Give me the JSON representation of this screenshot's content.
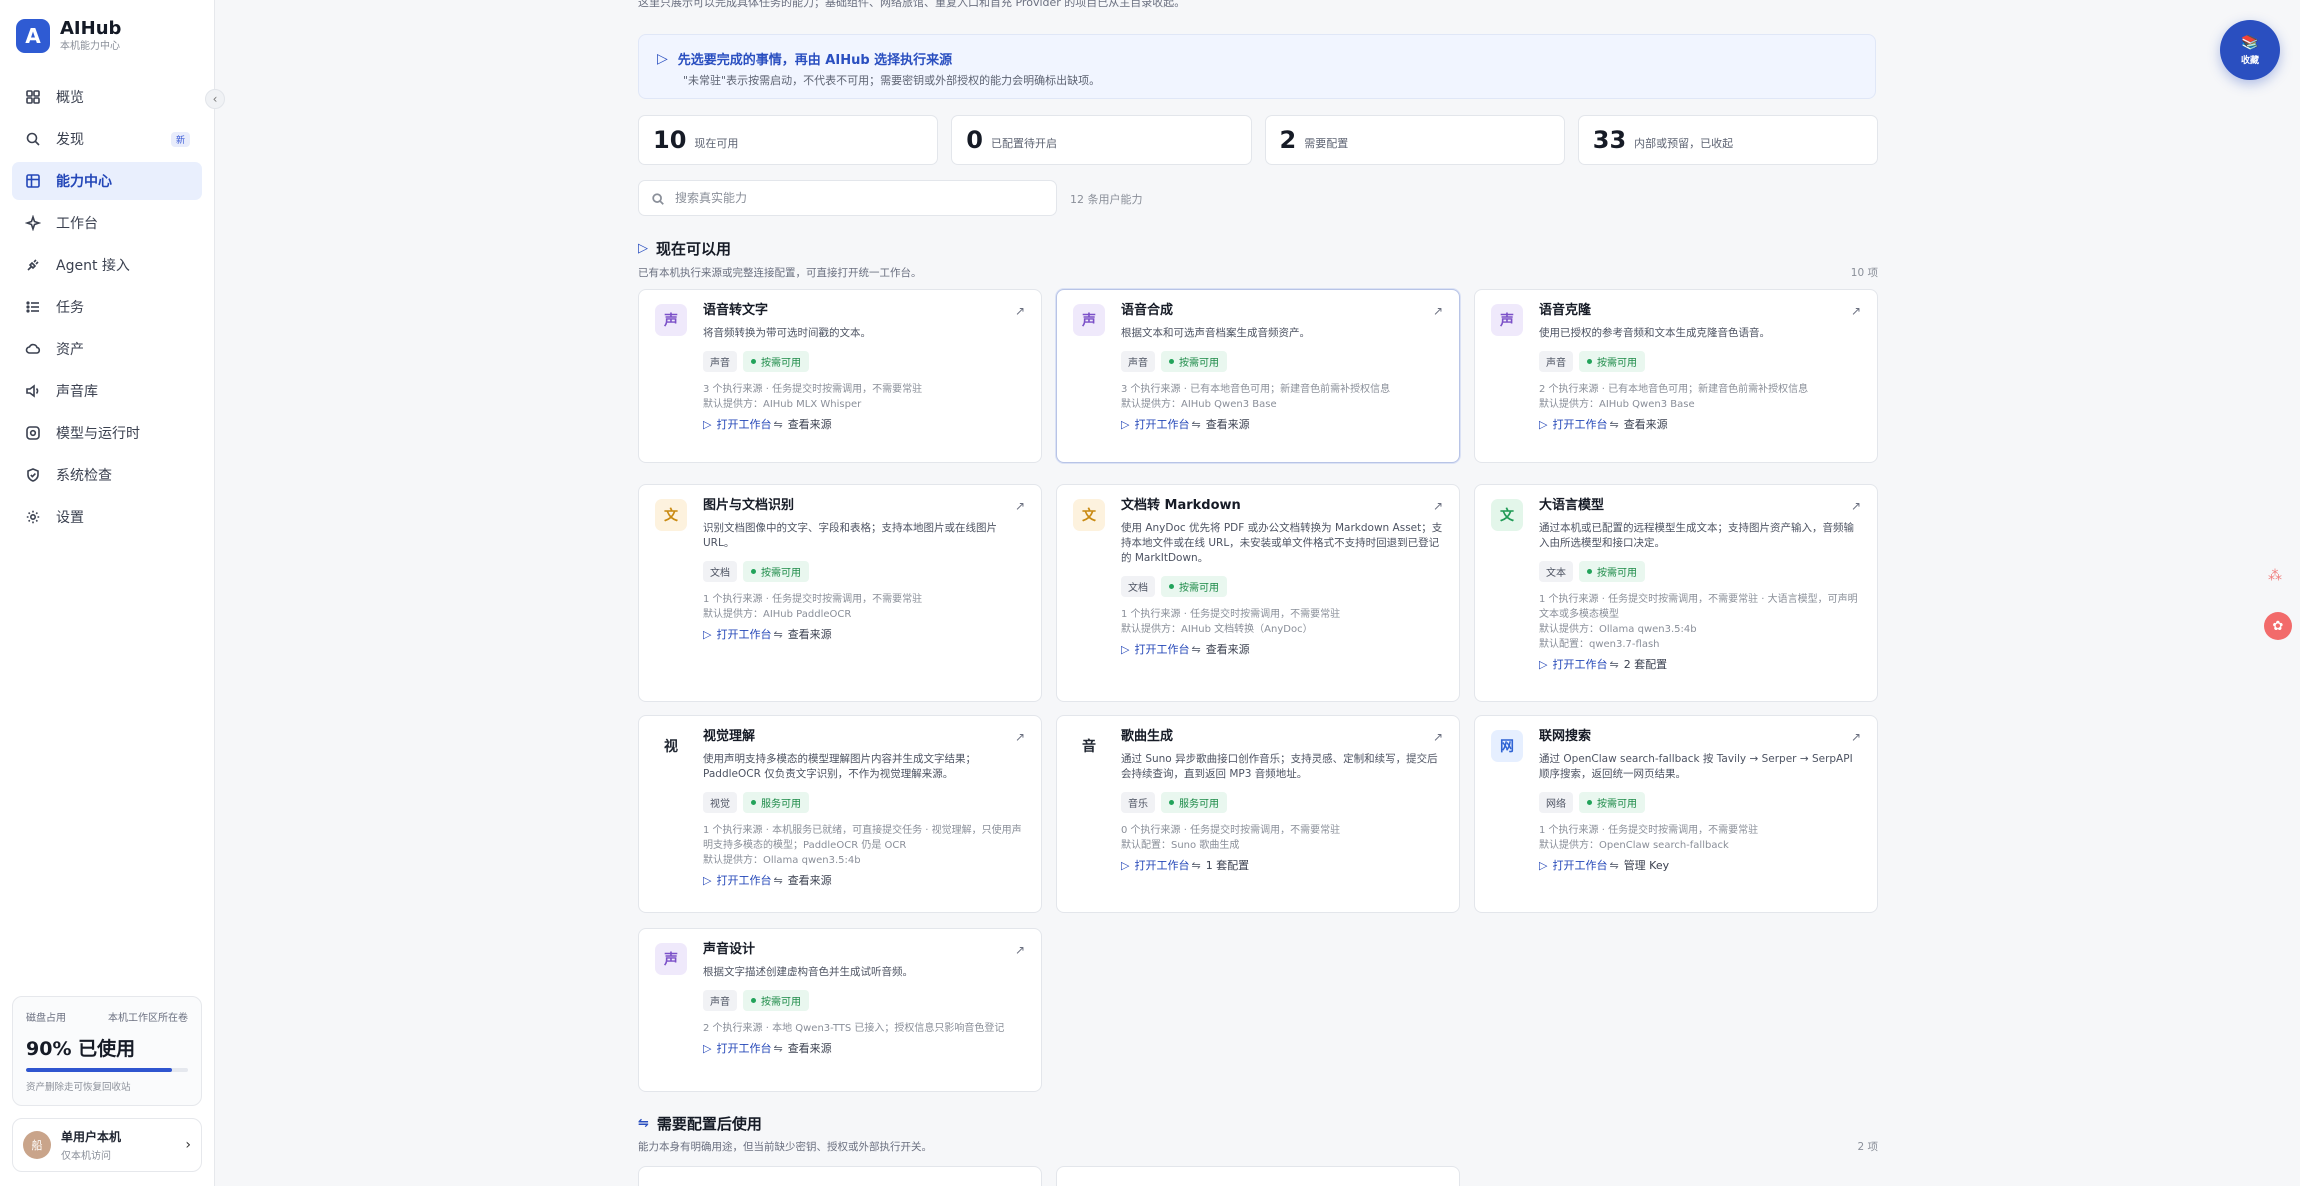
{
  "brand": {
    "logo": "A",
    "name": "AIHub",
    "subtitle": "本机能力中心"
  },
  "sidebar": {
    "collapse_icon": "‹",
    "items": [
      {
        "label": "概览",
        "icon": "grid-icon"
      },
      {
        "label": "发现",
        "icon": "search-icon",
        "badge": "新"
      },
      {
        "label": "能力中心",
        "icon": "table-icon",
        "active": true
      },
      {
        "label": "工作台",
        "icon": "sparkle-icon"
      },
      {
        "label": "Agent 接入",
        "icon": "plug-icon"
      },
      {
        "label": "任务",
        "icon": "list-icon"
      },
      {
        "label": "资产",
        "icon": "cloud-icon"
      },
      {
        "label": "声音库",
        "icon": "sound-icon"
      },
      {
        "label": "模型与运行时",
        "icon": "cog-icon"
      },
      {
        "label": "系统检查",
        "icon": "shield-icon"
      },
      {
        "label": "设置",
        "icon": "gear-icon"
      }
    ],
    "disk": {
      "label": "磁盘占用",
      "location": "本机工作区所在卷",
      "value": "90% 已使用",
      "percent": 0.9,
      "note": "资产删除走可恢复回收站"
    },
    "user": {
      "avatar": "船",
      "name": "单用户本机",
      "sub": "仅本机访问",
      "chevron": "›"
    }
  },
  "main": {
    "intro": "这里只展示可以完成具体任务的能力；基础组件、网络旅馆、重复入口和首充 Provider 的项目已从主目录收起。",
    "banner": {
      "icon": "▷",
      "title": "先选要完成的事情，再由 AIHub 选择执行来源",
      "desc": "\"未常驻\"表示按需启动，不代表不可用；需要密钥或外部授权的能力会明确标出缺项。"
    },
    "stats": [
      {
        "num": "10",
        "label": "现在可用"
      },
      {
        "num": "0",
        "label": "已配置待开启"
      },
      {
        "num": "2",
        "label": "需要配置"
      },
      {
        "num": "33",
        "label": "内部或预留，已收起"
      }
    ],
    "search": {
      "placeholder": "搜索真实能力",
      "count": "12 条用户能力"
    },
    "section1": {
      "icon": "▷",
      "title": "现在可以用",
      "subtitle": "已有本机执行来源或完整连接配置，可直接打开统一工作台。",
      "count": "10 项"
    },
    "section2": {
      "icon": "⇋",
      "title": "需要配置后使用",
      "subtitle": "能力本身有明确用途，但当前缺少密钥、授权或外部执行开关。",
      "count": "2 项"
    },
    "cards": [
      {
        "glyph": "声",
        "theme": "purple",
        "title": "语音转文字",
        "desc": "将音频转换为带可选时间戳的文本。",
        "tag": "声音",
        "status": "按需可用",
        "meta": "3 个执行来源 · 任务提交时按需调用，不需要常驻",
        "meta2": "默认提供方：AIHub MLX Whisper",
        "meta3": "",
        "open": "打开工作台",
        "secondary": "查看来源"
      },
      {
        "glyph": "声",
        "theme": "purple",
        "title": "语音合成",
        "desc": "根据文本和可选声音档案生成音频资产。",
        "tag": "声音",
        "status": "按需可用",
        "meta": "3 个执行来源 · 已有本地音色可用；新建音色前需补授权信息",
        "meta2": "默认提供方：AIHub Qwen3 Base",
        "meta3": "",
        "open": "打开工作台",
        "secondary": "查看来源"
      },
      {
        "glyph": "声",
        "theme": "purple",
        "title": "语音克隆",
        "desc": "使用已授权的参考音频和文本生成克隆音色语音。",
        "tag": "声音",
        "status": "按需可用",
        "meta": "2 个执行来源 · 已有本地音色可用；新建音色前需补授权信息",
        "meta2": "默认提供方：AIHub Qwen3 Base",
        "meta3": "",
        "open": "打开工作台",
        "secondary": "查看来源"
      },
      {
        "glyph": "文",
        "theme": "amber",
        "title": "图片与文档识别",
        "desc": "识别文档图像中的文字、字段和表格；支持本地图片或在线图片 URL。",
        "tag": "文档",
        "status": "按需可用",
        "meta": "1 个执行来源 · 任务提交时按需调用，不需要常驻",
        "meta2": "默认提供方：AIHub PaddleOCR",
        "meta3": "",
        "open": "打开工作台",
        "secondary": "查看来源"
      },
      {
        "glyph": "文",
        "theme": "amber",
        "title": "文档转 Markdown",
        "desc": "使用 AnyDoc 优先将 PDF 或办公文档转换为 Markdown Asset；支持本地文件或在线 URL，未安装或单文件格式不支持时回退到已登记的 MarkItDown。",
        "tag": "文档",
        "status": "按需可用",
        "meta": "1 个执行来源 · 任务提交时按需调用，不需要常驻",
        "meta2": "默认提供方：AIHub 文档转换（AnyDoc）",
        "meta3": "",
        "open": "打开工作台",
        "secondary": "查看来源"
      },
      {
        "glyph": "文",
        "theme": "green",
        "title": "大语言模型",
        "desc": "通过本机或已配置的远程模型生成文本；支持图片资产输入，音频输入由所选模型和接口决定。",
        "tag": "文本",
        "status": "按需可用",
        "meta": "1 个执行来源 · 任务提交时按需调用，不需要常驻 · 大语言模型，可声明文本或多模态模型",
        "meta2": "默认提供方：Ollama qwen3.5:4b",
        "meta3": "默认配置：qwen3.7-flash",
        "open": "打开工作台",
        "secondary": "2 套配置"
      },
      {
        "glyph": "视",
        "theme": "plain",
        "title": "视觉理解",
        "desc": "使用声明支持多模态的模型理解图片内容并生成文字结果；PaddleOCR 仅负责文字识别，不作为视觉理解来源。",
        "tag": "视觉",
        "status": "服务可用",
        "meta": "1 个执行来源 · 本机服务已就绪，可直接提交任务 · 视觉理解，只使用声明支持多模态的模型；PaddleOCR 仍是 OCR",
        "meta2": "默认提供方：Ollama qwen3.5:4b",
        "meta3": "",
        "open": "打开工作台",
        "secondary": "查看来源"
      },
      {
        "glyph": "音",
        "theme": "plain",
        "title": "歌曲生成",
        "desc": "通过 Suno 异步歌曲接口创作音乐；支持灵感、定制和续写，提交后会持续查询，直到返回 MP3 音频地址。",
        "tag": "音乐",
        "status": "服务可用",
        "meta": "0 个执行来源 · 任务提交时按需调用，不需要常驻",
        "meta2": "默认配置：Suno 歌曲生成",
        "meta3": "",
        "open": "打开工作台",
        "secondary": "1 套配置"
      },
      {
        "glyph": "网",
        "theme": "blue",
        "title": "联网搜索",
        "desc": "通过 OpenClaw search-fallback 按 Tavily → Serper → SerpAPI 顺序搜索，返回统一网页结果。",
        "tag": "网络",
        "status": "按需可用",
        "meta": "1 个执行来源 · 任务提交时按需调用，不需要常驻",
        "meta2": "默认提供方：OpenClaw search-fallback",
        "meta3": "",
        "open": "打开工作台",
        "secondary": "管理 Key"
      },
      {
        "glyph": "声",
        "theme": "purple",
        "title": "声音设计",
        "desc": "根据文字描述创建虚构音色并生成试听音频。",
        "tag": "声音",
        "status": "按需可用",
        "meta": "2 个执行来源 · 本地 Qwen3-TTS 已接入；授权信息只影响音色登记",
        "meta2": "",
        "meta3": "",
        "open": "打开工作台",
        "secondary": "查看来源"
      }
    ]
  },
  "fab": {
    "label": "收藏",
    "icon": "book-icon"
  },
  "colors": {
    "accent": "#2447b8",
    "purple_bg": "#efe9fb",
    "amber_bg": "#fdf2de",
    "green_bg": "#e3f6ea",
    "blue_bg": "#e6efff"
  }
}
